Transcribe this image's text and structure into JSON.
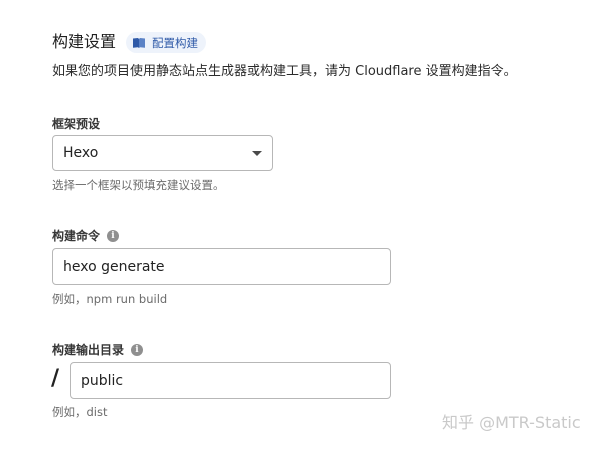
{
  "build_settings": {
    "title": "构建设置",
    "doc_link_label": "配置构建",
    "description": "如果您的项目使用静态站点生成器或构建工具，请为 Cloudflare 设置构建指令。"
  },
  "framework_preset": {
    "label": "框架预设",
    "selected": "Hexo",
    "help": "选择一个框架以预填充建议设置。"
  },
  "build_command": {
    "label": "构建命令",
    "value": "hexo generate",
    "help": "例如，npm run build"
  },
  "build_output": {
    "label": "构建输出目录",
    "prefix": "/",
    "value": "public",
    "help": "例如，dist"
  },
  "watermark": "知乎 @MTR-Static",
  "icons": {
    "doc": "book-icon",
    "info": "info-icon",
    "dropdown": "caret-down-icon"
  },
  "colors": {
    "accent": "#2f5aa8",
    "badge_bg": "#eef3fb",
    "border": "#b7b7b7"
  }
}
